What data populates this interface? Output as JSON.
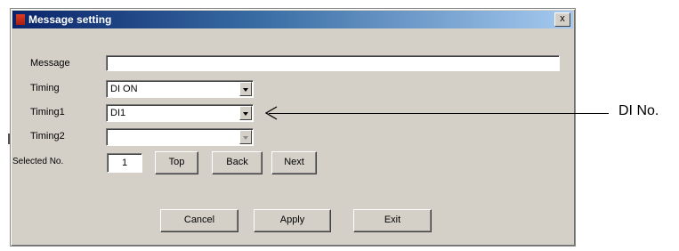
{
  "dialog": {
    "title": "Message setting",
    "close_label": "x"
  },
  "form": {
    "message_label": "Message",
    "message_value": "",
    "timing_label": "Timing",
    "timing_value": "DI ON",
    "timing1_label": "Timing1",
    "timing1_value": "DI1",
    "timing2_label": "Timing2",
    "timing2_value": "",
    "selected_no_label": "Selected No.",
    "selected_no_value": "1"
  },
  "nav_buttons": {
    "top": "Top",
    "back": "Back",
    "next": "Next"
  },
  "action_buttons": {
    "cancel": "Cancel",
    "apply": "Apply",
    "exit": "Exit"
  },
  "annotation": {
    "text": "DI No."
  }
}
